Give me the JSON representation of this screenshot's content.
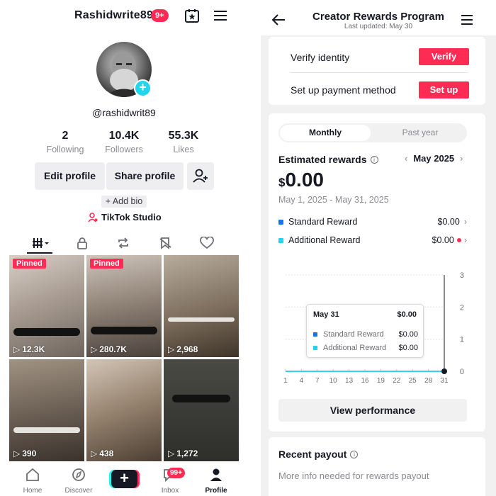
{
  "profile": {
    "username": "Rashidwrite89",
    "notification_badge": "9+",
    "handle": "@rashidwrit89",
    "stats": [
      {
        "value": "2",
        "label": "Following"
      },
      {
        "value": "10.4K",
        "label": "Followers"
      },
      {
        "value": "55.3K",
        "label": "Likes"
      }
    ],
    "edit_label": "Edit profile",
    "share_label": "Share profile",
    "add_bio_label": "+ Add bio",
    "studio_label": "TikTok Studio",
    "videos": [
      {
        "pinned": "Pinned",
        "views": "12.3K"
      },
      {
        "pinned": "Pinned",
        "views": "280.7K"
      },
      {
        "pinned": "",
        "views": "2,968"
      },
      {
        "pinned": "",
        "views": "390"
      },
      {
        "pinned": "",
        "views": "438"
      },
      {
        "pinned": "",
        "views": "1,272"
      }
    ],
    "nav": {
      "home": "Home",
      "discover": "Discover",
      "inbox": "Inbox",
      "inbox_badge": "99+",
      "profile": "Profile"
    },
    "colors": {
      "accent": "#fe2c55",
      "cyan": "#20d5ec"
    }
  },
  "rewards": {
    "title": "Creator Rewards Program",
    "last_updated": "Last updated: May 30",
    "verify_label": "Verify identity",
    "verify_button": "Verify",
    "payment_label": "Set up payment method",
    "payment_button": "Set up",
    "tabs": {
      "monthly": "Monthly",
      "past_year": "Past year"
    },
    "estimated_label": "Estimated rewards",
    "month": "May 2025",
    "amount_currency": "$",
    "amount_value": "0.00",
    "date_range": "May 1, 2025 - May 31, 2025",
    "standard_label": "Standard Reward",
    "standard_value": "$0.00",
    "additional_label": "Additional Reward",
    "additional_value": "$0.00",
    "tooltip": {
      "date": "May 31",
      "total": "$0.00",
      "standard_label": "Standard Reward",
      "standard_value": "$0.00",
      "additional_label": "Additional Reward",
      "additional_value": "$0.00"
    },
    "view_performance": "View performance",
    "recent_payout_title": "Recent payout",
    "recent_payout_note": "More info needed for rewards payout",
    "colors": {
      "standard": "#1a73e8",
      "additional": "#20d5ec"
    }
  },
  "chart_data": {
    "type": "line",
    "x": [
      "1",
      "4",
      "7",
      "10",
      "13",
      "16",
      "19",
      "22",
      "25",
      "28",
      "31"
    ],
    "series": [
      {
        "name": "Standard Reward",
        "values": [
          0,
          0,
          0,
          0,
          0,
          0,
          0,
          0,
          0,
          0,
          0
        ]
      },
      {
        "name": "Additional Reward",
        "values": [
          0,
          0,
          0,
          0,
          0,
          0,
          0,
          0,
          0,
          0,
          0
        ]
      }
    ],
    "y_ticks": [
      "3",
      "2",
      "1",
      "0"
    ],
    "ylim": [
      0,
      3
    ],
    "grid": true
  }
}
